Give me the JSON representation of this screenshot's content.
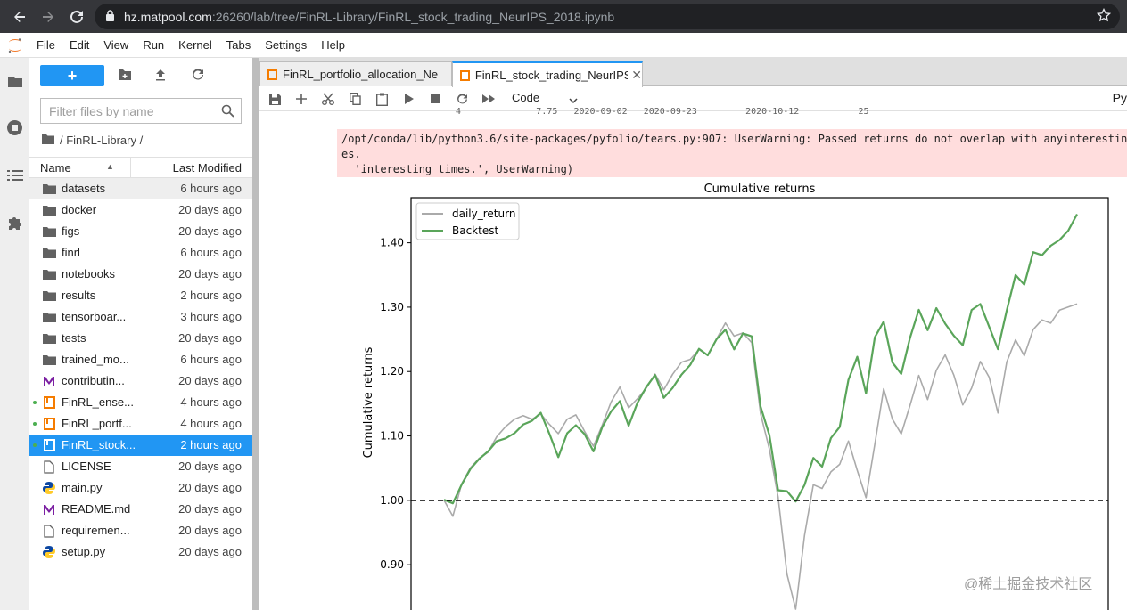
{
  "browser": {
    "url_host": "hz.matpool.com",
    "url_rest": ":26260/lab/tree/FinRL-Library/FinRL_stock_trading_NeurIPS_2018.ipynb"
  },
  "menubar": {
    "items": [
      "File",
      "Edit",
      "View",
      "Run",
      "Kernel",
      "Tabs",
      "Settings",
      "Help"
    ]
  },
  "filebrowser": {
    "new_label": "+",
    "filter_placeholder": "Filter files by name",
    "breadcrumb": "/ FinRL-Library /",
    "col_name": "Name",
    "col_modified": "Last Modified",
    "files": [
      {
        "name": "datasets",
        "modified": "6 hours ago",
        "icon": "folder-icon",
        "running": false
      },
      {
        "name": "docker",
        "modified": "20 days ago",
        "icon": "folder-icon",
        "running": false
      },
      {
        "name": "figs",
        "modified": "20 days ago",
        "icon": "folder-icon",
        "running": false
      },
      {
        "name": "finrl",
        "modified": "6 hours ago",
        "icon": "folder-icon",
        "running": false
      },
      {
        "name": "notebooks",
        "modified": "20 days ago",
        "icon": "folder-icon",
        "running": false
      },
      {
        "name": "results",
        "modified": "2 hours ago",
        "icon": "folder-icon",
        "running": false
      },
      {
        "name": "tensorboar...",
        "modified": "3 hours ago",
        "icon": "folder-icon",
        "running": false
      },
      {
        "name": "tests",
        "modified": "20 days ago",
        "icon": "folder-icon",
        "running": false
      },
      {
        "name": "trained_mo...",
        "modified": "6 hours ago",
        "icon": "folder-icon",
        "running": false
      },
      {
        "name": "contributin...",
        "modified": "20 days ago",
        "icon": "markdown-icon",
        "running": false
      },
      {
        "name": "FinRL_ense...",
        "modified": "4 hours ago",
        "icon": "notebook-icon",
        "running": true
      },
      {
        "name": "FinRL_portf...",
        "modified": "4 hours ago",
        "icon": "notebook-icon",
        "running": true
      },
      {
        "name": "FinRL_stock...",
        "modified": "2 hours ago",
        "icon": "notebook-icon",
        "running": true
      },
      {
        "name": "LICENSE",
        "modified": "20 days ago",
        "icon": "file-icon",
        "running": false
      },
      {
        "name": "main.py",
        "modified": "20 days ago",
        "icon": "python-icon",
        "running": false
      },
      {
        "name": "README.md",
        "modified": "20 days ago",
        "icon": "markdown-icon",
        "running": false
      },
      {
        "name": "requiremen...",
        "modified": "20 days ago",
        "icon": "file-icon",
        "running": false
      },
      {
        "name": "setup.py",
        "modified": "20 days ago",
        "icon": "python-icon",
        "running": false
      }
    ]
  },
  "tabs": [
    {
      "label": "FinRL_portfolio_allocation_Ne",
      "active": false
    },
    {
      "label": "FinRL_stock_trading_NeurIPS",
      "active": true
    }
  ],
  "notebook": {
    "cell_type": "Code",
    "kernel": "Py",
    "prev_output": "4              7.75   2020-09-02   2020-09-23         2020-10-12           25",
    "stderr_lines": [
      "/opt/conda/lib/python3.6/site-packages/pyfolio/tears.py:907: UserWarning: Passed returns do not overlap with anyinteresting",
      "es.",
      "  'interesting times.', UserWarning)"
    ]
  },
  "chart_data": {
    "type": "line",
    "title": "Cumulative returns",
    "xlabel": "",
    "ylabel": "Cumulative returns",
    "ylim": [
      0.82,
      1.47
    ],
    "yticks": [
      "0.90",
      "1.00",
      "1.10",
      "1.20",
      "1.30",
      "1.40"
    ],
    "ytick_values": [
      0.9,
      1.0,
      1.1,
      1.2,
      1.3,
      1.4
    ],
    "reference_line": 1.0,
    "legend_position": "top-left",
    "series": [
      {
        "name": "daily_return",
        "color": "#aaaaaa",
        "values": [
          1.0,
          0.97,
          1.02,
          1.05,
          1.07,
          1.08,
          1.1,
          1.11,
          1.12,
          1.13,
          1.13,
          1.14,
          1.12,
          1.1,
          1.12,
          1.13,
          1.11,
          1.09,
          1.12,
          1.15,
          1.17,
          1.14,
          1.16,
          1.18,
          1.2,
          1.17,
          1.19,
          1.21,
          1.22,
          1.24,
          1.23,
          1.25,
          1.27,
          1.25,
          1.26,
          1.25,
          1.14,
          1.08,
          1.0,
          0.88,
          0.83,
          0.95,
          1.03,
          1.02,
          1.04,
          1.05,
          1.09,
          1.05,
          1.01,
          1.09,
          1.17,
          1.12,
          1.1,
          1.15,
          1.2,
          1.16,
          1.2,
          1.22,
          1.19,
          1.15,
          1.18,
          1.22,
          1.19,
          1.13,
          1.21,
          1.25,
          1.23,
          1.27,
          1.28,
          1.27,
          1.29,
          1.3,
          1.31
        ]
      },
      {
        "name": "Backtest",
        "color": "#5aa55a",
        "values": [
          1.0,
          1.0,
          1.03,
          1.05,
          1.06,
          1.07,
          1.09,
          1.1,
          1.11,
          1.12,
          1.12,
          1.13,
          1.1,
          1.07,
          1.11,
          1.12,
          1.1,
          1.07,
          1.11,
          1.14,
          1.16,
          1.12,
          1.15,
          1.17,
          1.19,
          1.16,
          1.18,
          1.2,
          1.21,
          1.23,
          1.22,
          1.25,
          1.27,
          1.24,
          1.26,
          1.25,
          1.14,
          1.1,
          1.02,
          1.02,
          1.0,
          1.02,
          1.06,
          1.05,
          1.1,
          1.12,
          1.19,
          1.22,
          1.16,
          1.25,
          1.28,
          1.22,
          1.2,
          1.25,
          1.29,
          1.26,
          1.3,
          1.28,
          1.26,
          1.24,
          1.29,
          1.3,
          1.27,
          1.24,
          1.3,
          1.35,
          1.33,
          1.38,
          1.38,
          1.4,
          1.41,
          1.42,
          1.44
        ]
      }
    ]
  },
  "watermark": "@稀土掘金技术社区",
  "colors": {
    "accent": "#2196f3",
    "stderr_bg": "#ffdddd",
    "running_dot": "#4caf50"
  }
}
